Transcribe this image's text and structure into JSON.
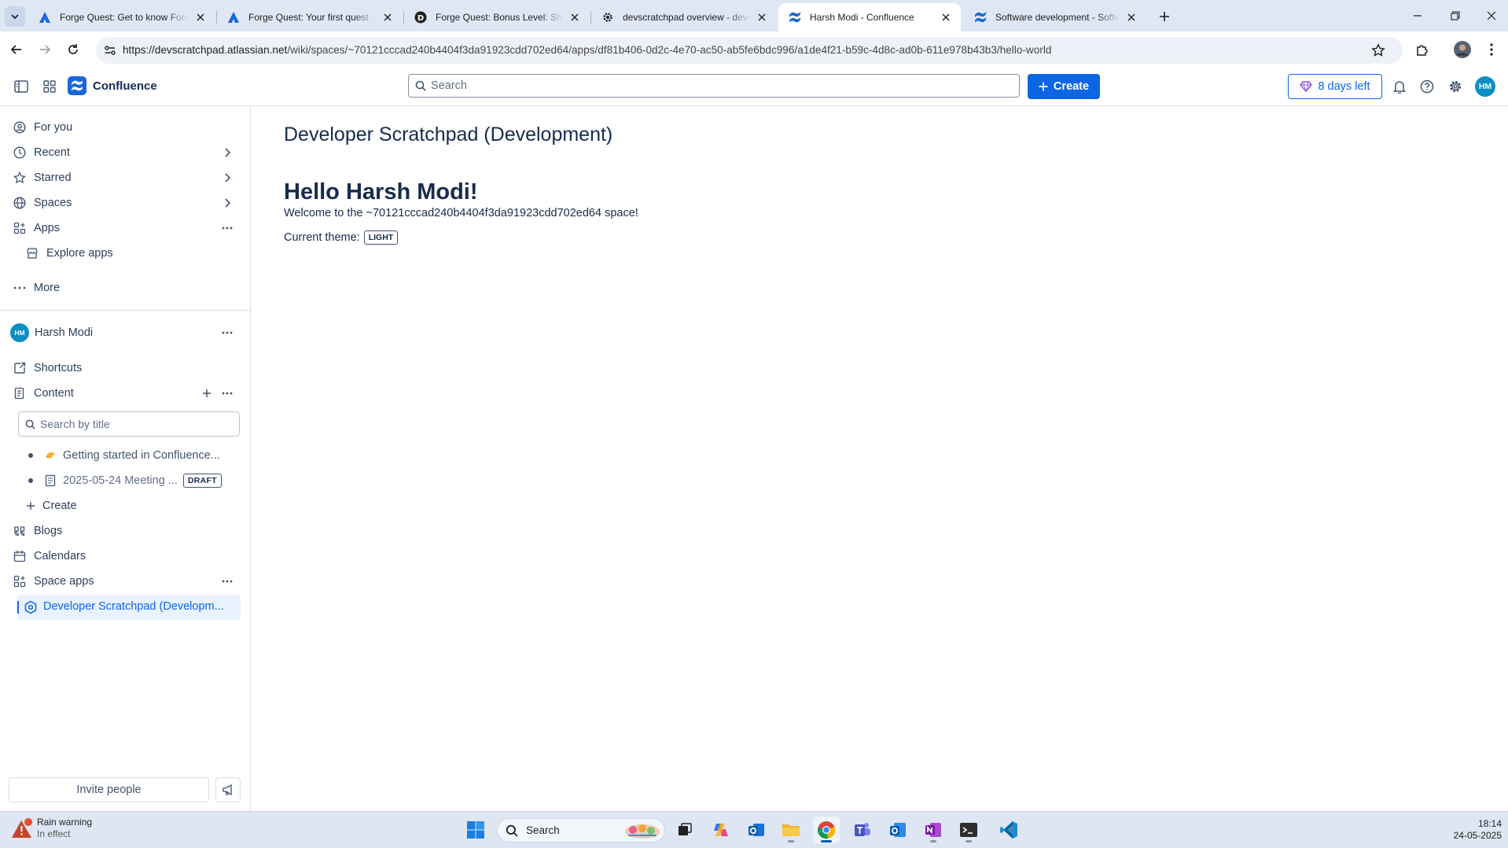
{
  "browser": {
    "tabs": [
      {
        "title": "Forge Quest: Get to know Forge",
        "icon": "atlassian-icon"
      },
      {
        "title": "Forge Quest: Your first quest - p",
        "icon": "atlassian-icon"
      },
      {
        "title": "Forge Quest: Bonus Level: Shari",
        "icon": "d-icon"
      },
      {
        "title": "devscratchpad overview - devsc",
        "icon": "gear-favicon-icon"
      },
      {
        "title": "Harsh Modi - Confluence",
        "icon": "confluence-icon"
      },
      {
        "title": "Software development - Softwa",
        "icon": "confluence-icon"
      }
    ],
    "url_host": "https://devscratchpad.atlassian.net",
    "url_path": "/wiki/spaces/~70121cccad240b4404f3da91923cdd702ed64/apps/df81b406-0d2c-4e70-ac50-ab5fe6bdc996/a1de4f21-b59c-4d8c-ad0b-611e978b43b3/hello-world"
  },
  "topnav": {
    "product_name": "Confluence",
    "search_placeholder": "Search",
    "create_label": "Create",
    "trial_label": "8 days left",
    "avatar_initials": "HM"
  },
  "sidebar": {
    "primary": [
      {
        "label": "For you",
        "icon": "person-circle-icon"
      },
      {
        "label": "Recent",
        "icon": "clock-icon",
        "right": "chevron-right-icon"
      },
      {
        "label": "Starred",
        "icon": "star-icon",
        "right": "chevron-right-icon"
      },
      {
        "label": "Spaces",
        "icon": "globe-icon",
        "right": "chevron-right-icon"
      },
      {
        "label": "Apps",
        "icon": "apps-icon",
        "right": "more-icon"
      }
    ],
    "explore_apps": "Explore apps",
    "more": "More",
    "space_name": "Harsh Modi",
    "space_avatar": "HM",
    "shortcuts": "Shortcuts",
    "content": "Content",
    "title_search_placeholder": "Search by title",
    "tree": [
      {
        "label": "Getting started in Confluence...",
        "icon": "wave-emoji-icon"
      },
      {
        "label": "2025-05-24 Meeting ...",
        "icon": "page-icon",
        "badge": "DRAFT"
      }
    ],
    "tree_create": "Create",
    "blogs": "Blogs",
    "calendars": "Calendars",
    "space_apps": "Space apps",
    "active_app": "Developer Scratchpad (Developm...",
    "invite": "Invite people"
  },
  "main": {
    "space_title": "Developer Scratchpad (Development)",
    "hello": "Hello Harsh Modi!",
    "welcome": "Welcome to the ~70121cccad240b4404f3da91923cdd702ed64 space!",
    "theme_label": "Current theme:",
    "theme_value": "LIGHT"
  },
  "taskbar": {
    "weather_title": "Rain warning",
    "weather_sub": "In effect",
    "search_placeholder": "Search",
    "time": "18:14",
    "date": "24-05-2025"
  },
  "colors": {
    "accent": "#0c66e4",
    "tabstrip": "#dfe7f5",
    "sidebar_active": "#e9f2ff",
    "text": "#172b4d"
  }
}
